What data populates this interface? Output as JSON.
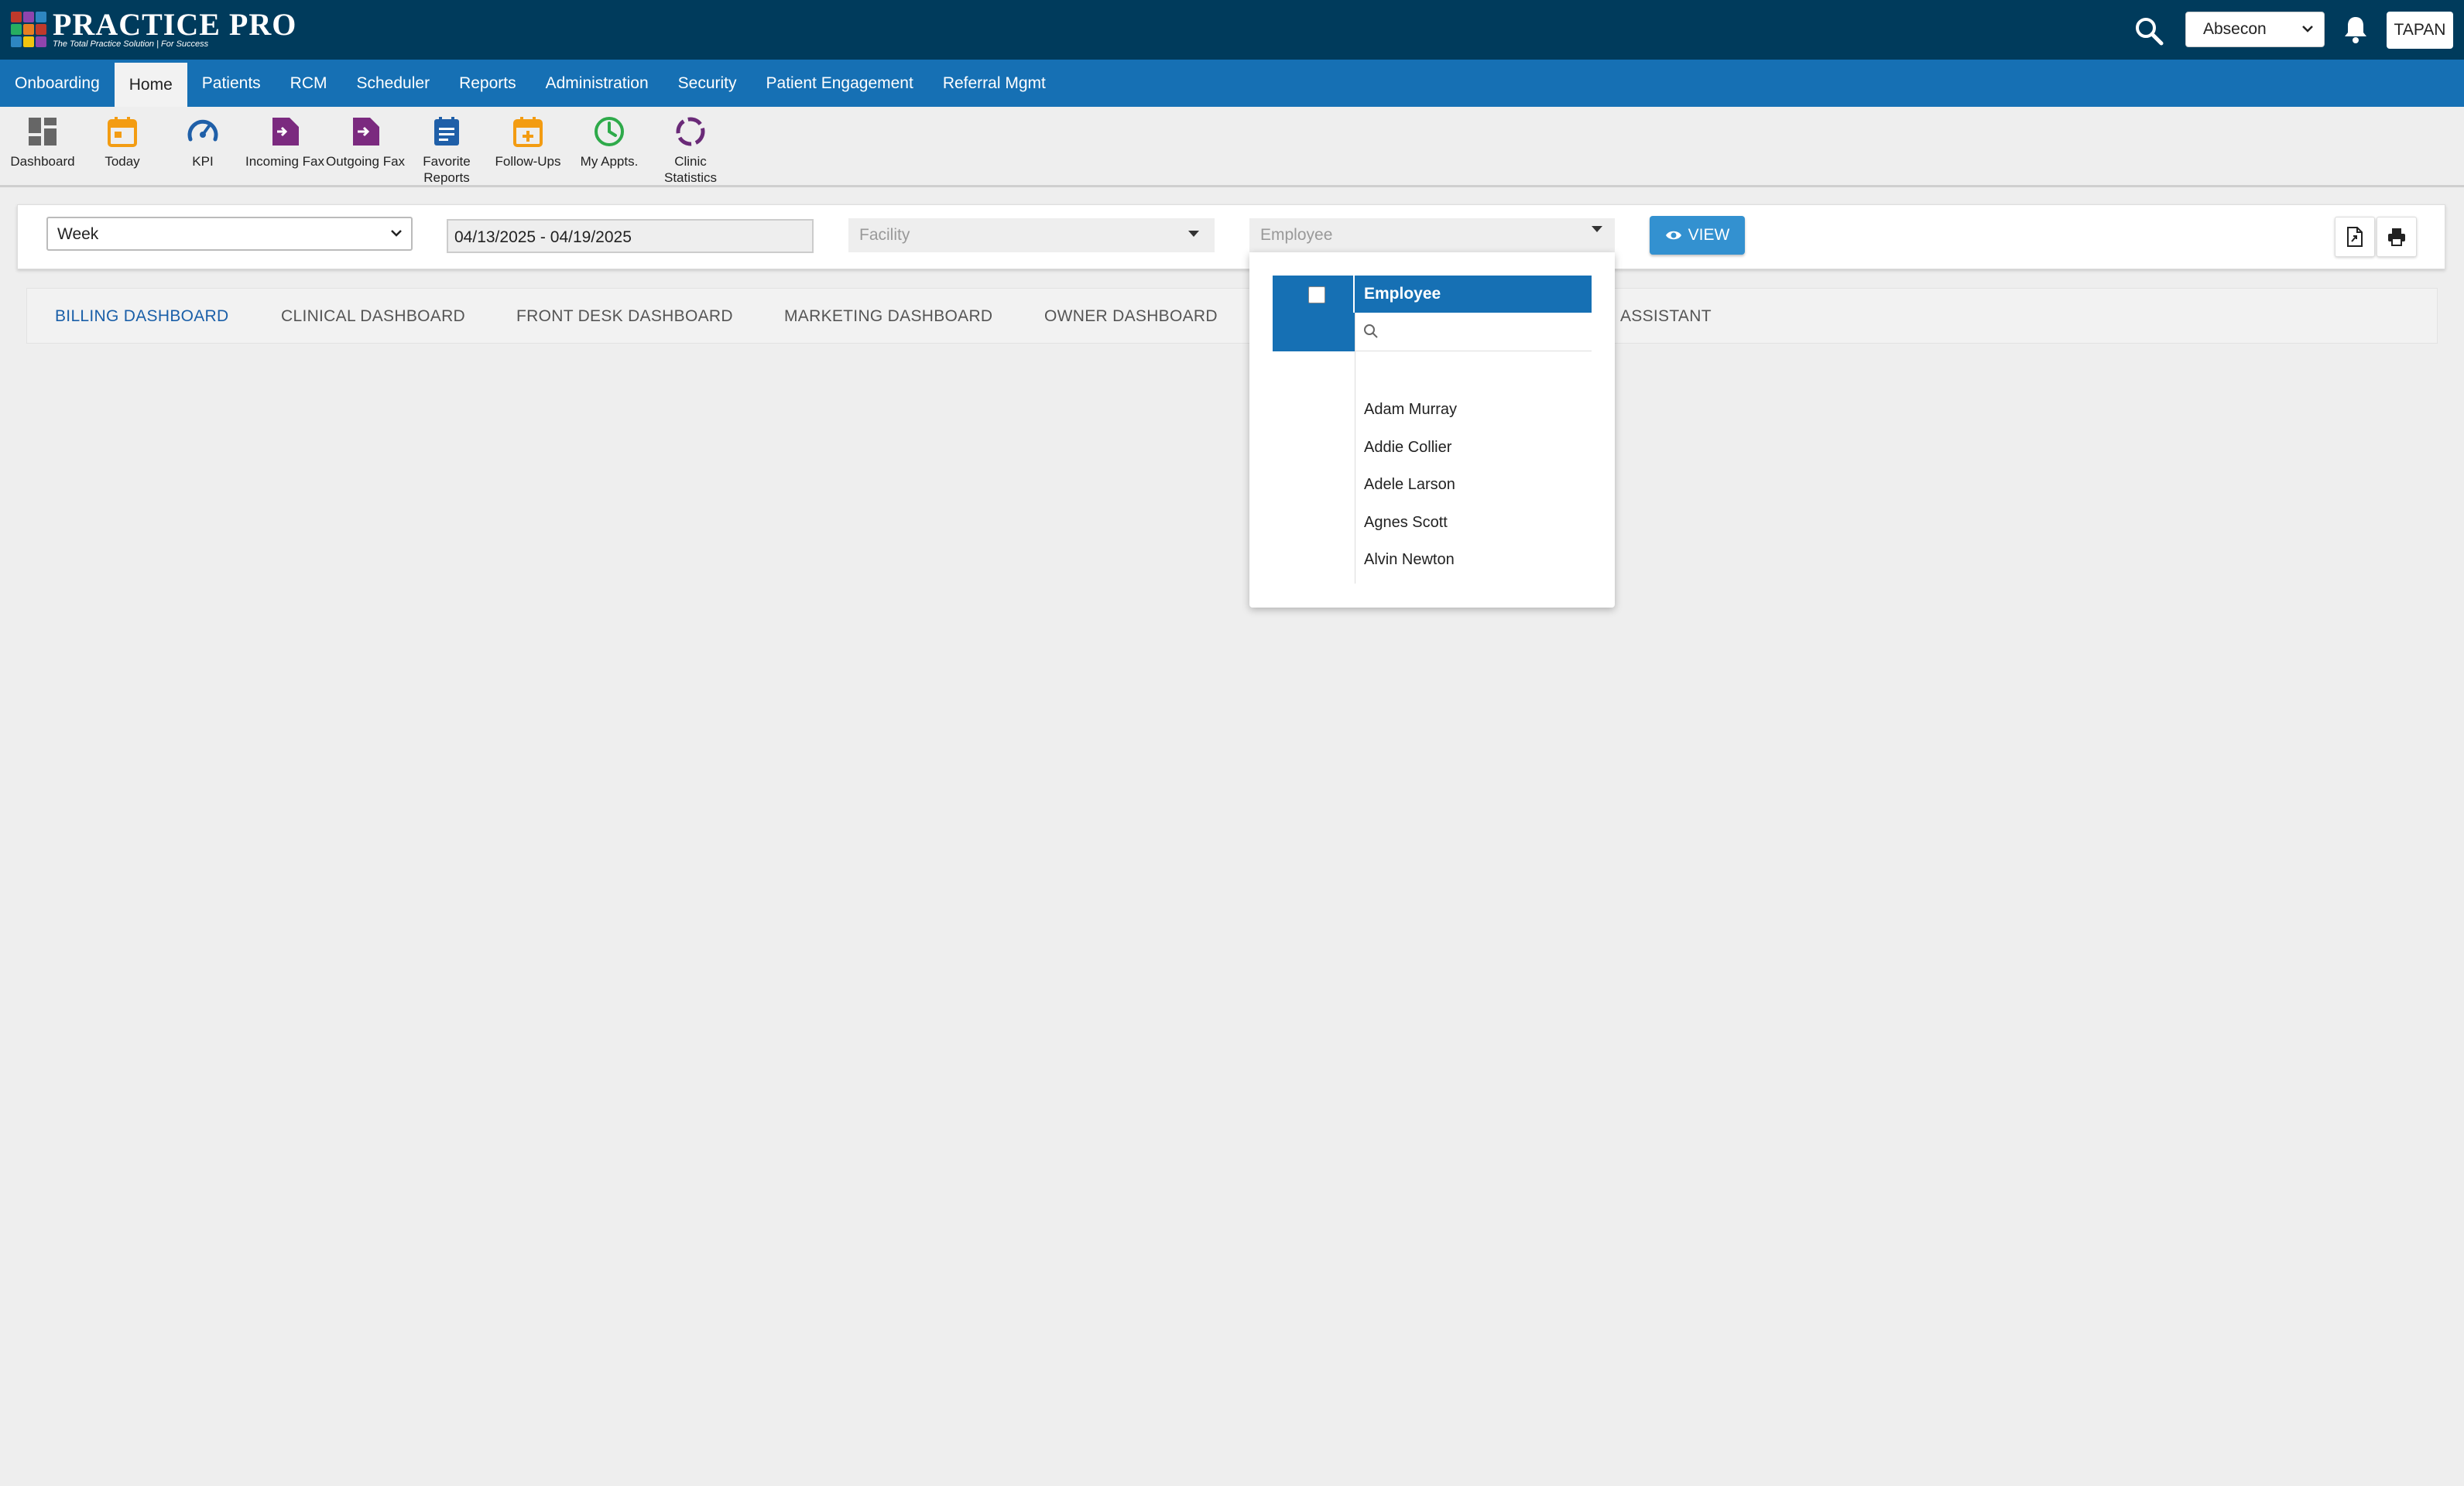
{
  "header": {
    "logo_name": "PRACTICE PRO",
    "logo_tagline": "The Total Practice Solution | For Success",
    "location": "Absecon",
    "user": "TAPAN"
  },
  "nav": {
    "items": [
      "Onboarding",
      "Home",
      "Patients",
      "RCM",
      "Scheduler",
      "Reports",
      "Administration",
      "Security",
      "Patient Engagement",
      "Referral Mgmt"
    ],
    "active": "Home"
  },
  "toolbar": {
    "items": [
      {
        "label": "Dashboard",
        "icon": "dashboard-icon"
      },
      {
        "label": "Today",
        "icon": "calendar-icon"
      },
      {
        "label": "KPI",
        "icon": "gauge-icon"
      },
      {
        "label": "Incoming Fax",
        "icon": "incoming-fax-icon"
      },
      {
        "label": "Outgoing Fax",
        "icon": "outgoing-fax-icon"
      },
      {
        "label": "Favorite Reports",
        "icon": "report-icon"
      },
      {
        "label": "Follow-Ups",
        "icon": "calendar-plus-icon"
      },
      {
        "label": "My Appts.",
        "icon": "clock-icon"
      },
      {
        "label": "Clinic Statistics",
        "icon": "ring-chart-icon"
      }
    ]
  },
  "filters": {
    "period": "Week",
    "date_range": "04/13/2025 - 04/19/2025",
    "facility_placeholder": "Facility",
    "employee_placeholder": "Employee",
    "view_label": "VIEW"
  },
  "tabs": {
    "items": [
      "BILLING DASHBOARD",
      "CLINICAL DASHBOARD",
      "FRONT DESK DASHBOARD",
      "MARKETING DASHBOARD",
      "OWNER DASHBOARD",
      "ASSISTANT"
    ],
    "active": "BILLING DASHBOARD"
  },
  "employee_dropdown": {
    "header": "Employee",
    "options": [
      "Adam Murray",
      "Addie Collier",
      "Adele Larson",
      "Agnes Scott",
      "Alvin Newton"
    ]
  },
  "colors": {
    "header_bg": "#003b5c",
    "nav_bg": "#1670b4",
    "view_button": "#3391d0",
    "active_tab": "#1a5fa8"
  }
}
